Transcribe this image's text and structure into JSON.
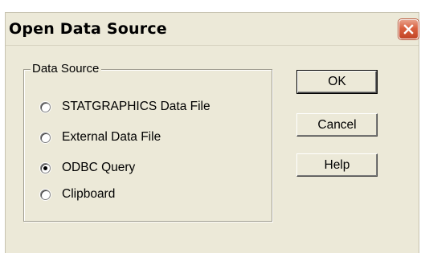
{
  "window": {
    "title": "Open Data Source"
  },
  "group": {
    "label": "Data Source",
    "options": [
      {
        "label": "STATGRAPHICS Data File",
        "selected": false
      },
      {
        "label": "External Data File",
        "selected": false
      },
      {
        "label": "ODBC Query",
        "selected": true
      },
      {
        "label": "Clipboard",
        "selected": false
      }
    ]
  },
  "buttons": {
    "ok": "OK",
    "cancel": "Cancel",
    "help": "Help"
  },
  "icons": {
    "close": "close-icon"
  },
  "colors": {
    "dialog_bg": "#ece9d8",
    "close_button": "#d9603f"
  }
}
